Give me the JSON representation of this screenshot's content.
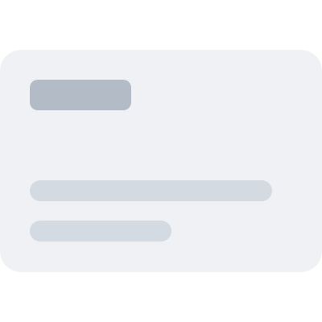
{
  "colors": {
    "background": "#ffffff",
    "card": "#f0f1f4",
    "title_bar": "#b3bcc6",
    "text_line": "#d4dae1"
  },
  "card": {
    "title_placeholder": "",
    "lines": [
      "",
      ""
    ]
  }
}
